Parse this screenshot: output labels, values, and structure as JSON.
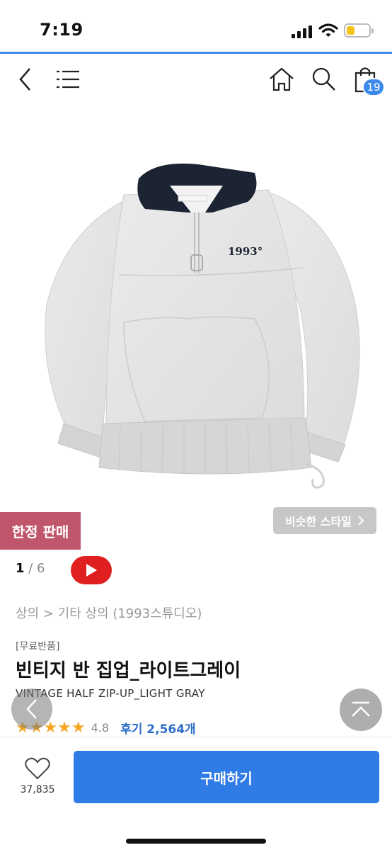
{
  "status_bar": {
    "time": "7:19"
  },
  "cart": {
    "count": "19"
  },
  "product": {
    "limited_badge": "한정 판매",
    "similar_style_label": "비슷한 스타일",
    "pager": {
      "current": "1",
      "separator": " / ",
      "total": "6"
    },
    "breadcrumb": "상의 > 기타 상의 (1993스튜디오)",
    "tag": "[무료반품]",
    "name_ko": "빈티지 반 집업_라이트그레이",
    "name_en": "VINTAGE HALF ZIP-UP_LIGHT GRAY",
    "rating": {
      "stars": "★★★★★",
      "score": "4.8",
      "reviews": "후기 2,564개"
    },
    "print_logo": "1993°"
  },
  "bottom_bar": {
    "like_count": "37,835",
    "buy_label": "구매하기"
  },
  "colors": {
    "accent": "#3d8ae8",
    "buy": "#2f7ce6",
    "limited": "#c0566b",
    "star": "#f5a623",
    "review_link": "#2f6ec9"
  },
  "icons": [
    "back-icon",
    "menu-icon",
    "home-icon",
    "search-icon",
    "cart-icon",
    "play-icon",
    "chevron-right-icon",
    "chevron-left-icon",
    "scroll-top-icon",
    "heart-icon"
  ]
}
